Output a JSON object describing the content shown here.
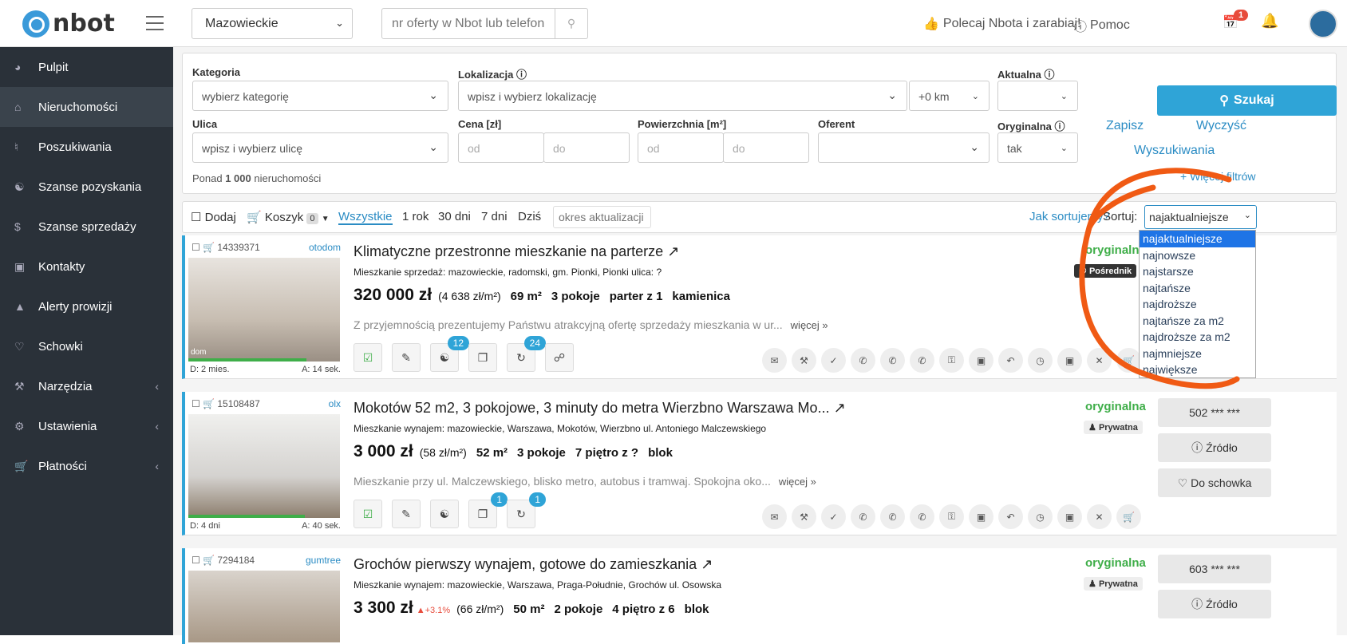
{
  "header": {
    "logo_text": "nbot",
    "region": "Mazowieckie",
    "search_placeholder": "nr oferty w Nbot lub telefon",
    "recommend": "Polecaj Nbota i zarabiaj!",
    "help": "Pomoc",
    "calendar_badge": "1"
  },
  "sidebar": {
    "items": [
      {
        "label": "Pulpit"
      },
      {
        "label": "Nieruchomości"
      },
      {
        "label": "Poszukiwania"
      },
      {
        "label": "Szanse pozyskania"
      },
      {
        "label": "Szanse sprzedaży"
      },
      {
        "label": "Kontakty"
      },
      {
        "label": "Alerty prowizji"
      },
      {
        "label": "Schowki"
      },
      {
        "label": "Narzędzia"
      },
      {
        "label": "Ustawienia"
      },
      {
        "label": "Płatności"
      }
    ]
  },
  "filters": {
    "kategoria_label": "Kategoria",
    "kategoria_value": "wybierz kategorię",
    "lokalizacja_label": "Lokalizacja",
    "lokalizacja_value": "wpisz i wybierz lokalizację",
    "radius": "+0 km",
    "aktualna_label": "Aktualna",
    "ulica_label": "Ulica",
    "ulica_value": "wpisz i wybierz ulicę",
    "cena_label": "Cena [zł]",
    "od": "od",
    "do": "do",
    "powierzchnia_label": "Powierzchnia [m²]",
    "oferent_label": "Oferent",
    "oryginalna_label": "Oryginalna",
    "oryginalna_value": "tak",
    "search_button": "Szukaj",
    "save_link": "Zapisz",
    "clear_link": "Wyczyść",
    "searches_link": "Wyszukiwania",
    "more_filters": "+ Więcej filtrów",
    "count_prefix": "Ponad",
    "count_value": "1 000",
    "count_suffix": "nieruchomości"
  },
  "toolbar": {
    "add": "Dodaj",
    "cart": "Koszyk",
    "cart_count": "0",
    "all": "Wszystkie",
    "year": "1 rok",
    "d30": "30 dni",
    "d7": "7 dni",
    "today": "Dziś",
    "period_placeholder": "okres aktualizacji",
    "how_sort": "Jak sortujemy?",
    "sort_label": "Sortuj:",
    "sort_value": "najaktualniejsze"
  },
  "sort_options": [
    "najaktualniejsze",
    "najnowsze",
    "najstarsze",
    "najtańsze",
    "najdroższe",
    "najtańsze za m2",
    "najdroższe za m2",
    "najmniejsze",
    "największe"
  ],
  "listings": [
    {
      "id": "14339371",
      "source": "otodom",
      "title": "Klimatyczne przestronne mieszkanie na parterze",
      "sub": "Mieszkanie sprzedaż: mazowieckie, radomski, gm. Pionki, Pionki ulica: ?",
      "price": "320 000 zł",
      "ppm": "(4 638 zł/m²)",
      "area": "69 m²",
      "rooms": "3 pokoje",
      "floor": "parter z 1",
      "type": "kamienica",
      "desc": "Z przyjemnością prezentujemy Państwu atrakcyjną ofertę sprzedaży mieszkania w ur...",
      "more": "więcej »",
      "d": "D: 2 mies.",
      "a": "A: 14 sek.",
      "orig": "oryginalna",
      "seller": "Pośrednik",
      "b1": "12",
      "b2": "24",
      "bar": 0.78,
      "thumb_label": "dom"
    },
    {
      "id": "15108487",
      "source": "olx",
      "title": "Mokotów 52 m2, 3 pokojowe, 3 minuty do metra Wierzbno Warszawa Mo...",
      "sub": "Mieszkanie wynajem: mazowieckie, Warszawa, Mokotów, Wierzbno ul. Antoniego Malczewskiego",
      "price": "3 000 zł",
      "ppm": "(58 zł/m²)",
      "area": "52 m²",
      "rooms": "3 pokoje",
      "floor": "7 piętro z ?",
      "type": "blok",
      "desc": "Mieszkanie przy ul. Malczewskiego, blisko metro, autobus i tramwaj. Spokojna oko...",
      "more": "więcej »",
      "d": "D: 4 dni",
      "a": "A: 40 sek.",
      "orig": "oryginalna",
      "seller": "Prywatna",
      "phone": "502 *** ***",
      "source_btn": "Źródło",
      "clip_btn": "Do schowka",
      "b1": "1",
      "b2": "1",
      "bar": 0.77
    },
    {
      "id": "7294184",
      "source": "gumtree",
      "title": "Grochów pierwszy wynajem, gotowe do zamieszkania",
      "sub": "Mieszkanie wynajem: mazowieckie, Warszawa, Praga-Południe, Grochów ul. Osowska",
      "price": "3 300 zł",
      "change": "+3.1%",
      "ppm": "(66 zł/m²)",
      "area": "50 m²",
      "rooms": "2 pokoje",
      "floor": "4 piętro z 6",
      "type": "blok",
      "orig": "oryginalna",
      "seller": "Prywatna",
      "phone": "603 *** ***",
      "source_btn": "Źródło"
    }
  ]
}
